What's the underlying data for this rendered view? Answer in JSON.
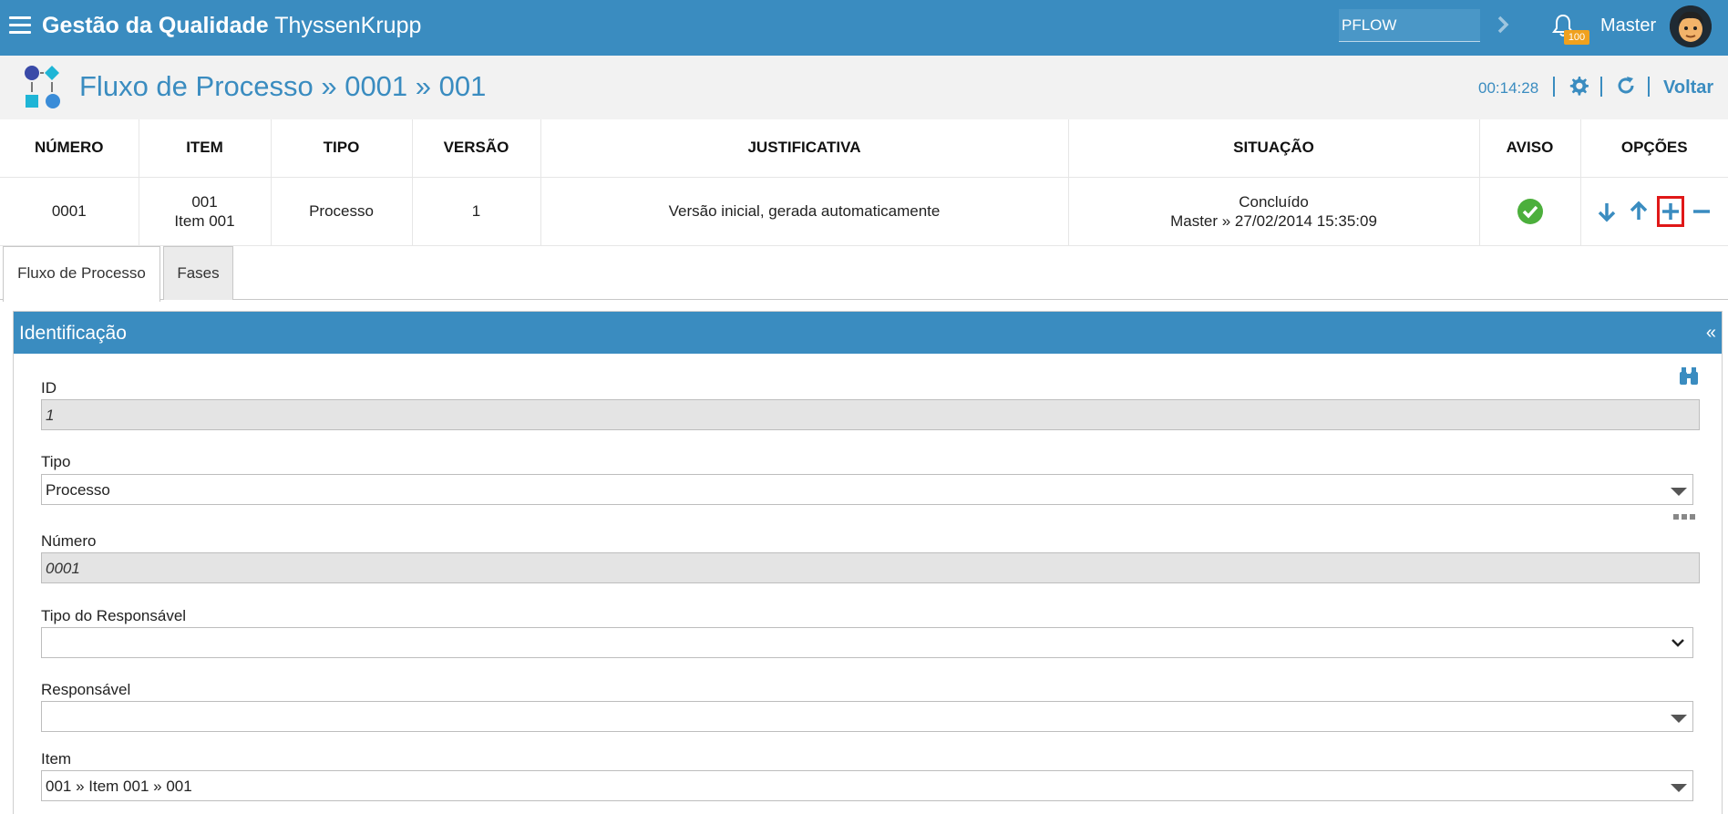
{
  "header": {
    "brand_bold": "Gestão da Qualidade",
    "brand_light": "ThyssenKrupp",
    "search_value": "PFLOW",
    "notifications": "100",
    "user": "Master"
  },
  "subheader": {
    "title": "Fluxo de Processo » 0001 » 001",
    "timer": "00:14:28",
    "back_label": "Voltar"
  },
  "table": {
    "headers": [
      "NÚMERO",
      "ITEM",
      "TIPO",
      "VERSÃO",
      "JUSTIFICATIVA",
      "SITUAÇÃO",
      "AVISO",
      "OPÇÕES"
    ],
    "row": {
      "numero": "0001",
      "item_code": "001",
      "item_name": "Item 001",
      "tipo": "Processo",
      "versao": "1",
      "justificativa": "Versão inicial, gerada automaticamente",
      "situacao_status": "Concluído",
      "situacao_detail": "Master » 27/02/2014 15:35:09"
    }
  },
  "tabs": [
    "Fluxo de Processo",
    "Fases"
  ],
  "panel": {
    "title": "Identificação",
    "collapse": "«",
    "fields": {
      "id_label": "ID",
      "id_value": "1",
      "tipo_label": "Tipo",
      "tipo_value": "Processo",
      "numero_label": "Número",
      "numero_value": "0001",
      "tipo_resp_label": "Tipo do Responsável",
      "tipo_resp_value": "",
      "resp_label": "Responsável",
      "resp_value": "",
      "item_label": "Item",
      "item_value": "001 » Item 001 » 001"
    }
  },
  "colors": {
    "primary": "#3a8cc0",
    "success": "#4caf3c",
    "highlight": "#e01818",
    "badge": "#f0a11e"
  }
}
